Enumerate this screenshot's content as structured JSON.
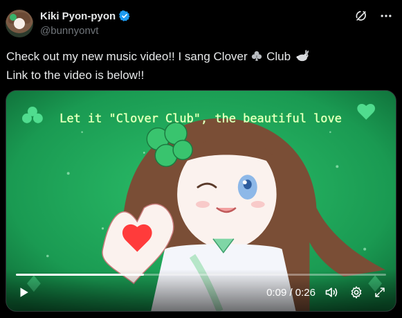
{
  "author": {
    "display_name": "Kiki Pyon-pyon",
    "handle": "@bunnyonvt",
    "verified": true,
    "verified_color": "#1d9bf0"
  },
  "top_actions": {
    "grok_icon": "grok-icon",
    "more_icon": "more-icon"
  },
  "tweet": {
    "line1_text": "Check out my new music video!! I sang Clover",
    "line1_mid": "Club",
    "line2": "Link to the video is below!!",
    "emoji_club": "club-suit-icon",
    "emoji_rabbit": "rabbit-icon"
  },
  "video": {
    "lyric": "Let it \"Clover Club\", the beautiful love",
    "current_time": "0:09",
    "duration": "0:26",
    "time_display": "0:09 / 0:26",
    "progress_fraction": 0.346,
    "colors": {
      "background": "#1f8f4b",
      "lyric_glow": "#d6ff98"
    }
  }
}
